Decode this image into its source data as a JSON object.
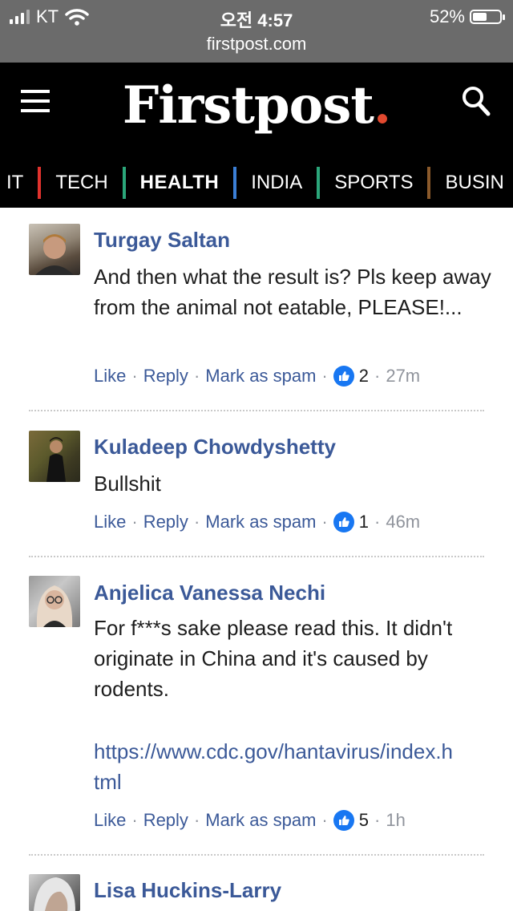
{
  "status_bar": {
    "carrier": "KT",
    "time": "오전 4:57",
    "battery_percent": "52%",
    "battery_level": 0.52,
    "url": "firstpost.com"
  },
  "header": {
    "logo_text": "Firstpost",
    "logo_dot": ".",
    "logo_dot_color": "#e2492f",
    "menu_icon": "hamburger-menu-icon",
    "search_icon": "search-icon"
  },
  "nav": {
    "items": [
      {
        "label": "IT",
        "bar_color": "#e0322d",
        "active": false
      },
      {
        "label": "TECH",
        "bar_color": "#2ba67a",
        "active": false
      },
      {
        "label": "HEALTH",
        "bar_color": "#3b7fd6",
        "active": true
      },
      {
        "label": "INDIA",
        "bar_color": "#2ba67a",
        "active": false
      },
      {
        "label": "SPORTS",
        "bar_color": "#8b5a2b",
        "active": false
      },
      {
        "label": "BUSIN",
        "bar_color": "",
        "active": false
      }
    ]
  },
  "comments": [
    {
      "author": "Turgay Saltan",
      "text": "And then what the result is? Pls keep away from the animal not eatable, PLEASE!...",
      "link": "",
      "like_label": "Like",
      "reply_label": "Reply",
      "spam_label": "Mark as spam",
      "likes": "2",
      "time": "27m"
    },
    {
      "author": "Kuladeep Chowdyshetty",
      "text": "Bullshit",
      "link": "",
      "like_label": "Like",
      "reply_label": "Reply",
      "spam_label": "Mark as spam",
      "likes": "1",
      "time": "46m"
    },
    {
      "author": "Anjelica Vanessa Nechi",
      "text": "For f***s sake please read this. It didn't originate in China and it's caused by rodents.",
      "link": "https://www.cdc.gov/hantavirus/index.html",
      "link_line1": "https://www.cdc.gov/hantavirus/index.h",
      "link_line2": "tml",
      "like_label": "Like",
      "reply_label": "Reply",
      "spam_label": "Mark as spam",
      "likes": "5",
      "time": "1h"
    },
    {
      "author": "Lisa Huckins-Larry"
    }
  ],
  "colors": {
    "link_blue": "#3b5998",
    "like_badge": "#1877f2",
    "meta_gray": "#90949c"
  }
}
